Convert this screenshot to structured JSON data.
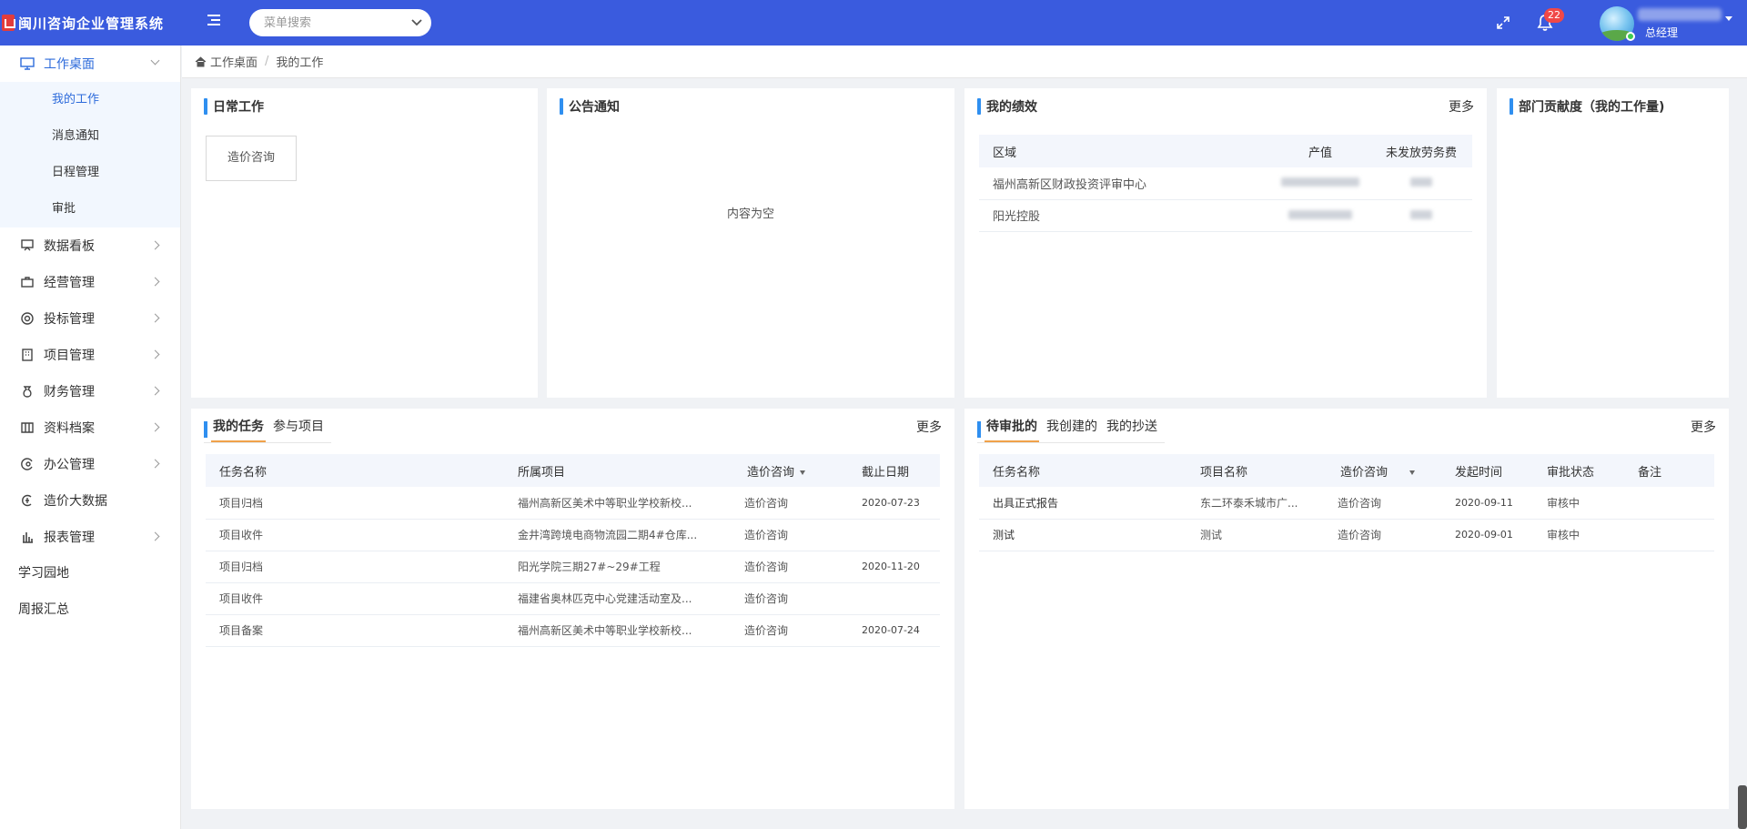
{
  "app": {
    "title": "闽川咨询企业管理系统",
    "search_placeholder": "菜单搜索",
    "notification_count": "22",
    "user_role": "总经理",
    "accent_color": "#3a5bde"
  },
  "sidebar": {
    "group_workbench": {
      "label": "工作桌面",
      "items": [
        "我的工作",
        "消息通知",
        "日程管理",
        "审批"
      ]
    },
    "items": [
      {
        "label": "数据看板",
        "icon": "dashboard-icon"
      },
      {
        "label": "经营管理",
        "icon": "briefcase-icon"
      },
      {
        "label": "投标管理",
        "icon": "target-icon"
      },
      {
        "label": "项目管理",
        "icon": "building-icon"
      },
      {
        "label": "财务管理",
        "icon": "money-bag-icon"
      },
      {
        "label": "资料档案",
        "icon": "archive-icon"
      },
      {
        "label": "办公管理",
        "icon": "office-icon"
      },
      {
        "label": "造价大数据",
        "icon": "data-icon"
      },
      {
        "label": "报表管理",
        "icon": "report-icon"
      }
    ],
    "plain_items": [
      "学习园地",
      "周报汇总"
    ]
  },
  "breadcrumb": {
    "home": "工作桌面",
    "current": "我的工作"
  },
  "daily_work": {
    "title": "日常工作",
    "button": "造价咨询"
  },
  "notice": {
    "title": "公告通知",
    "empty": "内容为空"
  },
  "performance": {
    "title": "我的绩效",
    "more": "更多",
    "headers": [
      "区域",
      "产值",
      "未发放劳务费"
    ],
    "rows": [
      {
        "region": "福州高新区财政投资评审中心"
      },
      {
        "region": "阳光控股"
      }
    ]
  },
  "contribution": {
    "title": "部门贡献度（我的工作量)"
  },
  "tasks": {
    "tabs": [
      "我的任务",
      "参与项目"
    ],
    "more": "更多",
    "headers": [
      "任务名称",
      "所属项目",
      "造价咨询",
      "截止日期"
    ],
    "rows": [
      {
        "name": "项目归档",
        "project": "福州高新区美术中等职业学校新校...",
        "type": "造价咨询",
        "deadline": "2020-07-23"
      },
      {
        "name": "项目收件",
        "project": "金井湾跨境电商物流园二期4#仓库...",
        "type": "造价咨询",
        "deadline": ""
      },
      {
        "name": "项目归档",
        "project": "阳光学院三期27#~29#工程",
        "type": "造价咨询",
        "deadline": "2020-11-20"
      },
      {
        "name": "项目收件",
        "project": "福建省奥林匹克中心党建活动室及...",
        "type": "造价咨询",
        "deadline": ""
      },
      {
        "name": "项目备案",
        "project": "福州高新区美术中等职业学校新校...",
        "type": "造价咨询",
        "deadline": "2020-07-24"
      }
    ]
  },
  "approvals": {
    "tabs": [
      "待审批的",
      "我创建的",
      "我的抄送"
    ],
    "more": "更多",
    "headers": [
      "任务名称",
      "项目名称",
      "造价咨询",
      "发起时间",
      "审批状态",
      "备注"
    ],
    "rows": [
      {
        "name": "出具正式报告",
        "project": "东二环泰禾城市广...",
        "type": "造价咨询",
        "time": "2020-09-11",
        "status": "审核中",
        "note": ""
      },
      {
        "name": "测试",
        "project": "测试",
        "type": "造价咨询",
        "time": "2020-09-01",
        "status": "审核中",
        "note": ""
      }
    ]
  }
}
